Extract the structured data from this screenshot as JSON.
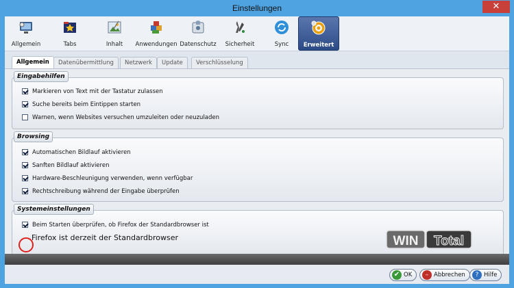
{
  "window": {
    "title": "Einstellungen",
    "close_glyph": "✕"
  },
  "toolbar": {
    "items": [
      {
        "label": "Allgemein",
        "icon": "general-icon"
      },
      {
        "label": "Tabs",
        "icon": "tabs-icon"
      },
      {
        "label": "Inhalt",
        "icon": "content-icon"
      },
      {
        "label": "Anwendungen",
        "icon": "applications-icon"
      },
      {
        "label": "Datenschutz",
        "icon": "privacy-icon"
      },
      {
        "label": "Sicherheit",
        "icon": "security-icon"
      },
      {
        "label": "Sync",
        "icon": "sync-icon"
      },
      {
        "label": "Erweitert",
        "icon": "advanced-gear-icon",
        "active": true
      }
    ]
  },
  "subtabs": [
    "Allgemein",
    "Datenübermittlung",
    "Netzwerk",
    "Update",
    "Verschlüsselung"
  ],
  "groups": {
    "eingabehilfen": {
      "title": "Eingabehilfen",
      "options": [
        {
          "label": "Markieren von Text mit der Tastatur zulassen",
          "checked": true
        },
        {
          "label": "Suche bereits beim Eintippen starten",
          "checked": true
        },
        {
          "label": "Warnen, wenn Websites versuchen umzuleiten oder neuzuladen",
          "checked": false
        }
      ]
    },
    "browsing": {
      "title": "Browsing",
      "options": [
        {
          "label": "Automatischen Bildlauf aktivieren",
          "checked": true
        },
        {
          "label": "Sanften Bildlauf aktivieren",
          "checked": true
        },
        {
          "label": "Hardware-Beschleunigung verwenden, wenn verfügbar",
          "checked": true
        },
        {
          "label": "Rechtschreibung während der Eingabe überprüfen",
          "checked": true
        }
      ]
    },
    "system": {
      "title": "Systemeinstellungen",
      "options": [
        {
          "label": "Beim Starten überprüfen, ob Firefox der Standardbrowser ist",
          "checked": true
        }
      ],
      "status": "Firefox ist derzeit der Standardbrowser"
    }
  },
  "watermark": {
    "part1": "WIN",
    "part2": "Total"
  },
  "footer": {
    "ok": "OK",
    "cancel": "Abbrechen",
    "help": "Hilfe"
  },
  "colors": {
    "accent": "#2c4b86",
    "annotation": "#e0201a",
    "window": "#4fa3e0"
  }
}
